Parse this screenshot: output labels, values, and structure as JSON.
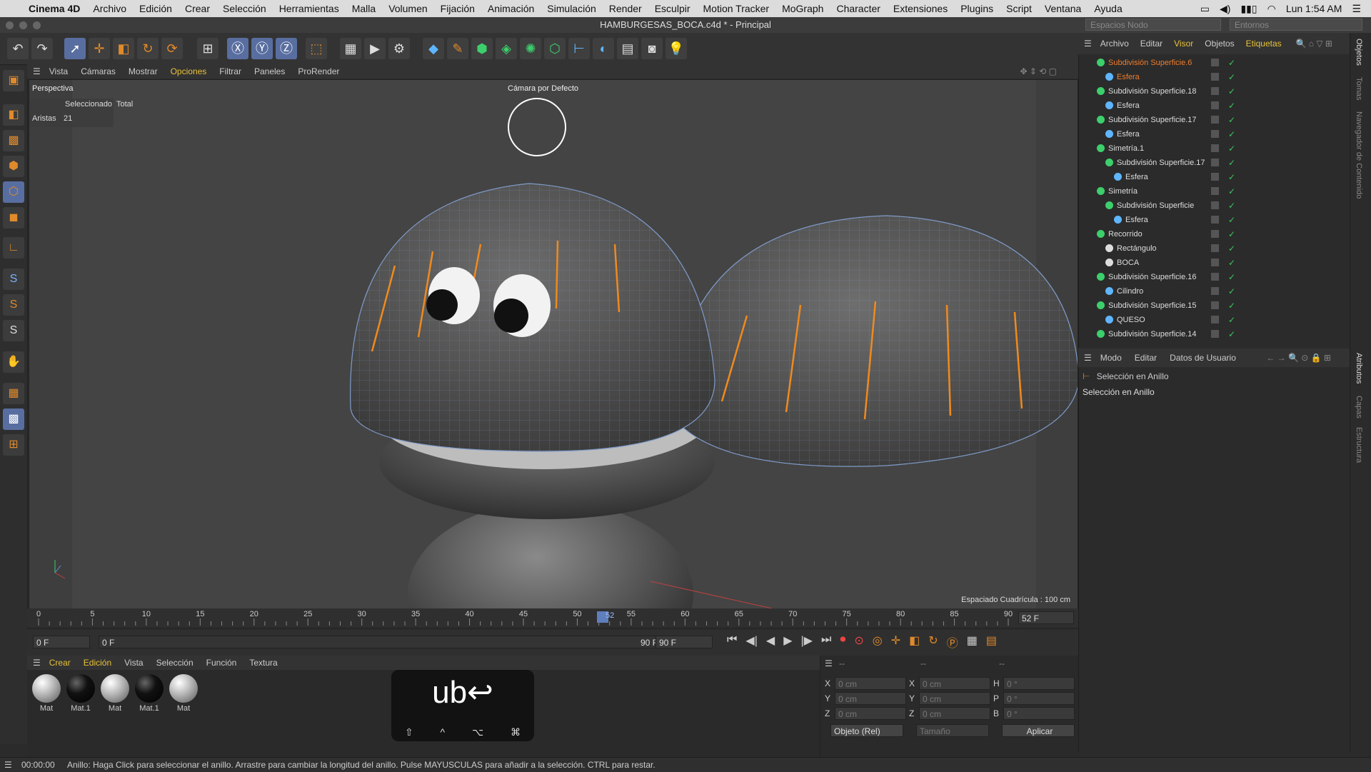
{
  "menubar": {
    "app": "Cinema 4D",
    "items": [
      "Archivo",
      "Edición",
      "Crear",
      "Selección",
      "Herramientas",
      "Malla",
      "Volumen",
      "Fijación",
      "Animación",
      "Simulación",
      "Render",
      "Esculpir",
      "Motion Tracker",
      "MoGraph",
      "Character",
      "Extensiones",
      "Plugins",
      "Script",
      "Ventana",
      "Ayuda"
    ],
    "clock": "Lun 1:54 AM"
  },
  "window": {
    "title": "HAMBURGESAS_BOCA.c4d * - Principal",
    "node_space": "Espacios Nodo",
    "environment": "Entornos"
  },
  "viewport": {
    "menu": [
      "Vista",
      "Cámaras",
      "Mostrar",
      "Opciones",
      "Filtrar",
      "Paneles",
      "ProRender"
    ],
    "active_menu": "Opciones",
    "name": "Perspectiva",
    "camera": "Cámara por Defecto",
    "hud_headers": [
      "Seleccionado",
      "Total"
    ],
    "hud_label": "Aristas",
    "hud_value": "21",
    "grid_spacing": "Espaciado Cuadrícula : 100 cm"
  },
  "timeline": {
    "ticks": [
      "0",
      "5",
      "10",
      "15",
      "20",
      "25",
      "30",
      "35",
      "40",
      "45",
      "50",
      "55",
      "60",
      "65",
      "70",
      "75",
      "80",
      "85",
      "90"
    ],
    "current_frame": "52",
    "current_frame_field": "52 F",
    "start": "0 F",
    "range_start": "0 F",
    "range_end": "90 F",
    "end": "90 F"
  },
  "material_manager": {
    "menu": [
      "Crear",
      "Edición",
      "Vista",
      "Selección",
      "Función",
      "Textura"
    ],
    "materials": [
      {
        "name": "Mat",
        "color": "#bdbdbd"
      },
      {
        "name": "Mat.1",
        "color": "#111111"
      },
      {
        "name": "Mat",
        "color": "#bdbdbd"
      },
      {
        "name": "Mat.1",
        "color": "#111111"
      },
      {
        "name": "Mat",
        "color": "#bdbdbd"
      }
    ]
  },
  "coordinates": {
    "header": [
      "--",
      "--",
      "--"
    ],
    "rows": [
      {
        "a": "X",
        "av": "0 cm",
        "b": "X",
        "bv": "0 cm",
        "c": "H",
        "cv": "0 °"
      },
      {
        "a": "Y",
        "av": "0 cm",
        "b": "Y",
        "bv": "0 cm",
        "c": "P",
        "cv": "0 °"
      },
      {
        "a": "Z",
        "av": "0 cm",
        "b": "Z",
        "bv": "0 cm",
        "c": "B",
        "cv": "0 °"
      }
    ],
    "mode": "Objeto (Rel)",
    "size": "Tamaño",
    "apply": "Aplicar"
  },
  "object_manager": {
    "menu": [
      "Archivo",
      "Editar",
      "Visor",
      "Objetos",
      "Etiquetas"
    ],
    "rows": [
      {
        "name": "Subdivisión Superficie.6",
        "indent": 0,
        "type": "subd",
        "selected": true
      },
      {
        "name": "Esfera",
        "indent": 1,
        "type": "sphere",
        "selected": true
      },
      {
        "name": "Subdivisión Superficie.18",
        "indent": 0,
        "type": "subd",
        "selected": false
      },
      {
        "name": "Esfera",
        "indent": 1,
        "type": "sphere",
        "selected": false
      },
      {
        "name": "Subdivisión Superficie.17",
        "indent": 0,
        "type": "subd",
        "selected": false
      },
      {
        "name": "Esfera",
        "indent": 1,
        "type": "sphere",
        "selected": false
      },
      {
        "name": "Simetría.1",
        "indent": 0,
        "type": "sym",
        "selected": false
      },
      {
        "name": "Subdivisión Superficie.17",
        "indent": 1,
        "type": "subd",
        "selected": false
      },
      {
        "name": "Esfera",
        "indent": 2,
        "type": "sphere",
        "selected": false
      },
      {
        "name": "Simetría",
        "indent": 0,
        "type": "sym",
        "selected": false
      },
      {
        "name": "Subdivisión Superficie",
        "indent": 1,
        "type": "subd",
        "selected": false
      },
      {
        "name": "Esfera",
        "indent": 2,
        "type": "sphere",
        "selected": false
      },
      {
        "name": "Recorrido",
        "indent": 0,
        "type": "sweep",
        "selected": false
      },
      {
        "name": "Rectángulo",
        "indent": 1,
        "type": "spline",
        "selected": false
      },
      {
        "name": "BOCA",
        "indent": 1,
        "type": "spline",
        "selected": false
      },
      {
        "name": "Subdivisión Superficie.16",
        "indent": 0,
        "type": "subd",
        "selected": false
      },
      {
        "name": "Cilindro",
        "indent": 1,
        "type": "sphere",
        "selected": false
      },
      {
        "name": "Subdivisión Superficie.15",
        "indent": 0,
        "type": "subd",
        "selected": false
      },
      {
        "name": "QUESO",
        "indent": 1,
        "type": "sphere",
        "selected": false
      },
      {
        "name": "Subdivisión Superficie.14",
        "indent": 0,
        "type": "subd",
        "selected": false
      }
    ]
  },
  "attributes": {
    "menu": [
      "Modo",
      "Editar",
      "Datos de Usuario"
    ],
    "tool_title": "Selección en Anillo",
    "tool_name": "Selección en Anillo"
  },
  "side_tabs": [
    "Objetos",
    "Tomas",
    "Navegador de Contenido",
    "Atributos",
    "Capas",
    "Estructura"
  ],
  "status": {
    "time": "00:00:00",
    "message": "Anillo: Haga Click para seleccionar el anillo. Arrastre para cambiar la longitud del anillo. Pulse MAYUSCULAS para añadir a la selección. CTRL para restar."
  },
  "keystroke_overlay": {
    "text": "ub↩",
    "modifiers": [
      "⇧",
      "^",
      "⌥",
      "⌘"
    ]
  },
  "colors": {
    "accent": "#e08a2b",
    "selection": "#f07d2b",
    "check": "#39c85b"
  }
}
